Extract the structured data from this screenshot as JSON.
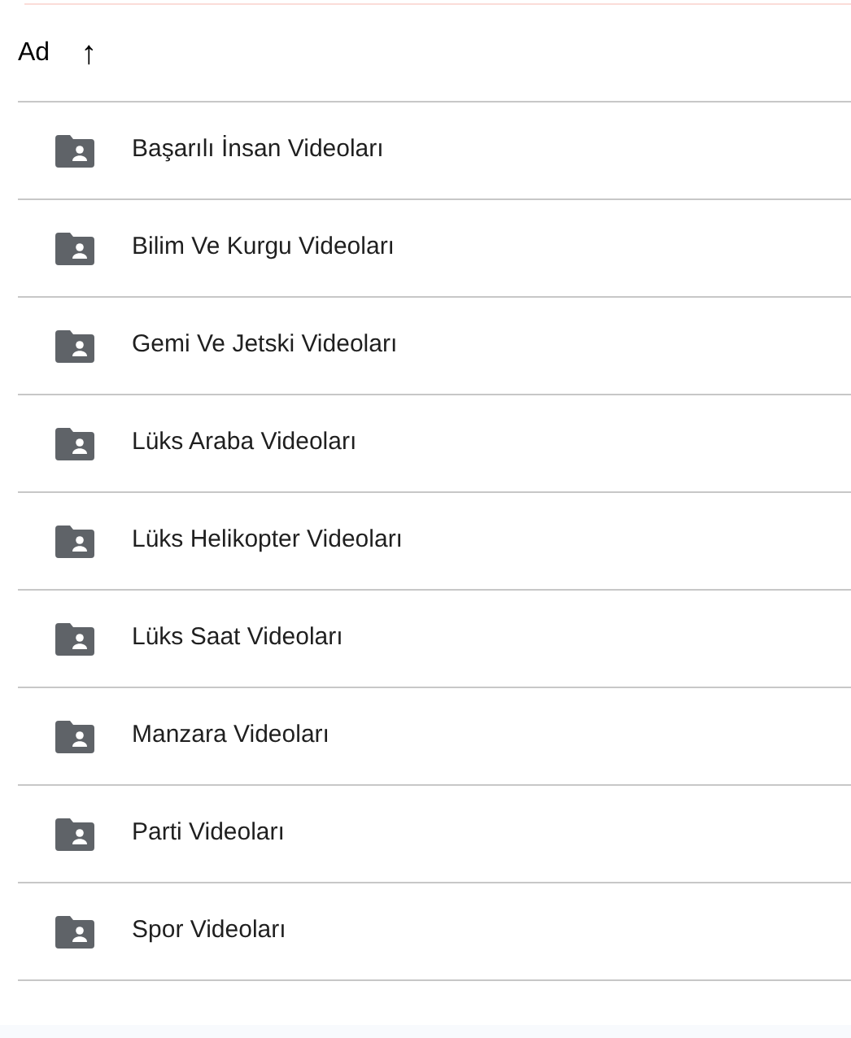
{
  "header": {
    "label": "Ad",
    "sort_icon": "↑"
  },
  "folders": [
    {
      "name": "Başarılı İnsan Videoları"
    },
    {
      "name": "Bilim Ve Kurgu Videoları"
    },
    {
      "name": "Gemi Ve Jetski Videoları"
    },
    {
      "name": "Lüks Araba Videoları"
    },
    {
      "name": "Lüks Helikopter Videoları"
    },
    {
      "name": "Lüks Saat Videoları"
    },
    {
      "name": "Manzara Videoları"
    },
    {
      "name": "Parti Videoları"
    },
    {
      "name": "Spor Videoları"
    }
  ]
}
